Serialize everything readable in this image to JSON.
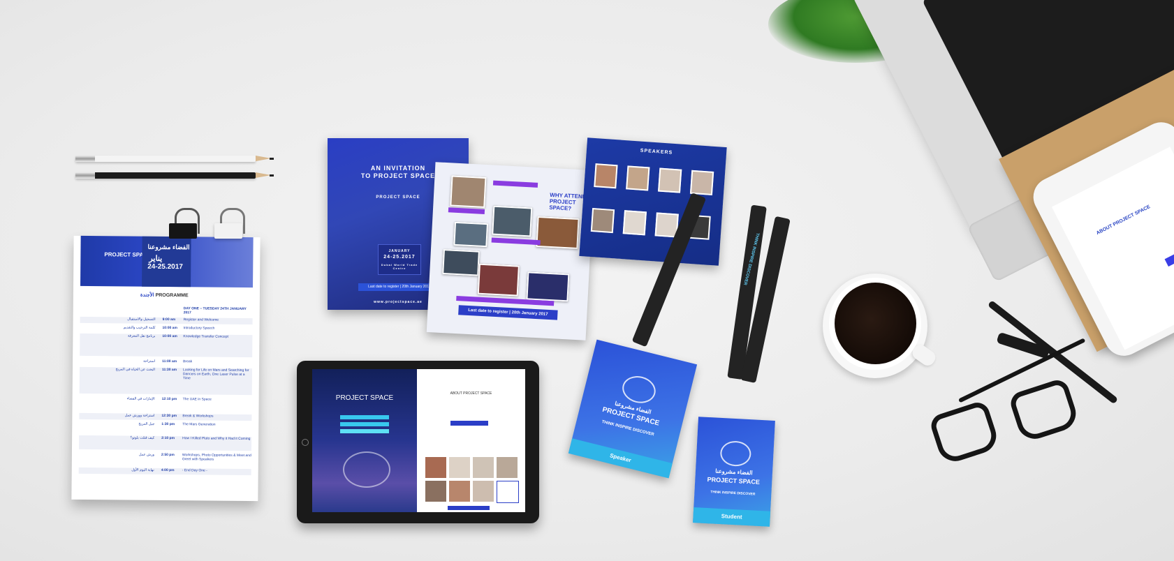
{
  "program": {
    "arabic_title": "الفضاء مشروعنا",
    "arabic_month": "يناير",
    "dates": "24-25.2017",
    "section_ar": "الأجندة",
    "section_en": "PROGRAMME",
    "day_en": "DAY ONE – TUESDAY 24TH JANUARY 2017",
    "rows": [
      {
        "time": "9:00 am",
        "en": "Register and Welcome",
        "ar": "التسجيل والاستقبال"
      },
      {
        "time": "10:00 am",
        "en": "Introductory Speech",
        "ar": "كلمة الترحيب والتقديم"
      },
      {
        "time": "10:00 am",
        "en": "Knowledge Transfer Concept",
        "ar": "برنامج نقل المعرفة"
      },
      {
        "time": "11:00 am",
        "en": "Break",
        "ar": "استراحة"
      },
      {
        "time": "11:30 am",
        "en": "Looking for Life on Mars and Searching for Dancers on Earth, One Laser Pulse at a Time",
        "ar": "البحث عن الحياة في المريخ"
      },
      {
        "time": "12:10 pm",
        "en": "The UAE in Space",
        "ar": "الإمارات في الفضاء"
      },
      {
        "time": "12:30 pm",
        "en": "Break & Workshops",
        "ar": "استراحة وورش عمل"
      },
      {
        "time": "1:30 pm",
        "en": "The Mars Generation",
        "ar": "جيل المريخ"
      },
      {
        "time": "2:10 pm",
        "en": "How I Killed Pluto and Why it Had it Coming",
        "ar": "كيف قتلت بلوتو؟"
      },
      {
        "time": "2:50 pm",
        "en": "Workshops, Photo Opportunities & Meet and Greet with Speakers",
        "ar": "ورش عمل"
      },
      {
        "time": "4:00 pm",
        "en": "- End Day One -",
        "ar": "نهاية اليوم الأول"
      }
    ]
  },
  "invitation": {
    "title_line1": "AN INVITATION",
    "title_line2": "TO PROJECT SPACE",
    "brand": "PROJECT SPACE",
    "month": "JANUARY",
    "dates": "24-25.2017",
    "venue": "Dubai World Trade Centre",
    "deadline": "Last date to register | 20th January 2017",
    "website": "www.projectspace.ae"
  },
  "why_attend": {
    "title": "WHY ATTEND PROJECT SPACE?",
    "deadline": "Last date to register | 20th January 2017"
  },
  "speakers": {
    "title": "SPEAKERS"
  },
  "tablet": {
    "hero_title": "PROJECT SPACE",
    "about_title": "ABOUT PROJECT SPACE"
  },
  "badges": {
    "speaker": {
      "brand_ar": "الفضاء مشروعنا",
      "brand": "PROJECT SPACE",
      "tagline": "THINK INSPIRE DISCOVER",
      "role": "Speaker"
    },
    "student": {
      "brand_ar": "الفضاء مشروعنا",
      "brand": "PROJECT SPACE",
      "tagline": "THINK INSPIRE DISCOVER",
      "role": "Student"
    }
  },
  "lanyard": {
    "text": "THINK INSPIRE DISCOVER"
  },
  "phone": {
    "title": "ABOUT PROJECT SPACE"
  },
  "colors": {
    "brand_blue": "#2b46c4",
    "badge_cyan": "#2fb5e8",
    "background": "#ececec"
  }
}
